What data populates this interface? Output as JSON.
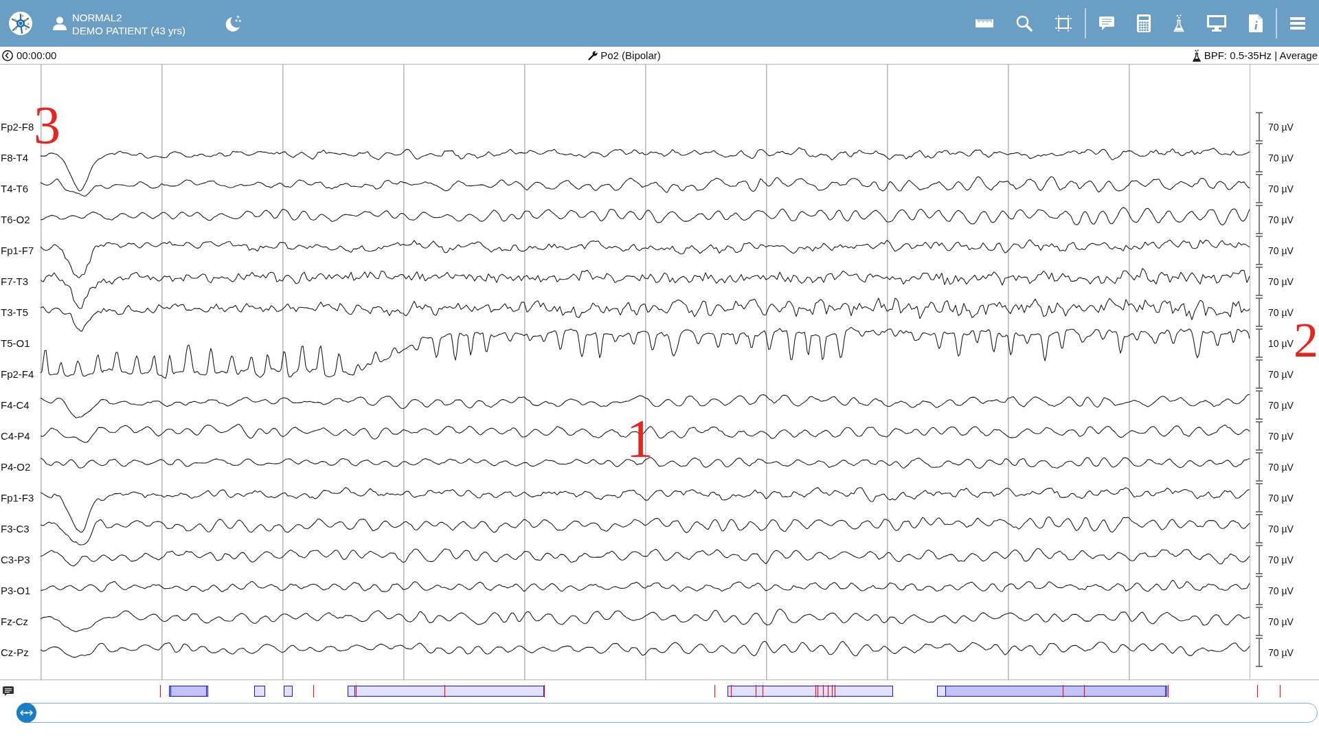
{
  "header": {
    "recording": "NORMAL2",
    "patient": "DEMO PATIENT (43 yrs)"
  },
  "info_bar": {
    "time": "00:00:00",
    "montage": "Po2 (Bipolar)",
    "filter": "BPF: 0.5-35Hz | Average"
  },
  "channels": [
    {
      "label": "Fp2-F8",
      "scale": "70 µV"
    },
    {
      "label": "F8-T4",
      "scale": "70 µV"
    },
    {
      "label": "T4-T6",
      "scale": "70 µV"
    },
    {
      "label": "T6-O2",
      "scale": "70 µV"
    },
    {
      "label": "Fp1-F7",
      "scale": "70 µV"
    },
    {
      "label": "F7-T3",
      "scale": "70 µV"
    },
    {
      "label": "T3-T5",
      "scale": "70 µV"
    },
    {
      "label": "T5-O1",
      "scale": "10 µV"
    },
    {
      "label": "Fp2-F4",
      "scale": "70 µV"
    },
    {
      "label": "F4-C4",
      "scale": "70 µV"
    },
    {
      "label": "C4-P4",
      "scale": "70 µV"
    },
    {
      "label": "P4-O2",
      "scale": "70 µV"
    },
    {
      "label": "Fp1-F3",
      "scale": "70 µV"
    },
    {
      "label": "F3-C3",
      "scale": "70 µV"
    },
    {
      "label": "C3-P3",
      "scale": "70 µV"
    },
    {
      "label": "P3-O1",
      "scale": "70 µV"
    },
    {
      "label": "Fz-Cz",
      "scale": "70 µV"
    },
    {
      "label": "Cz-Pz",
      "scale": "70 µV"
    }
  ],
  "callouts": [
    {
      "label": "3"
    },
    {
      "label": "2"
    },
    {
      "label": "1"
    }
  ]
}
